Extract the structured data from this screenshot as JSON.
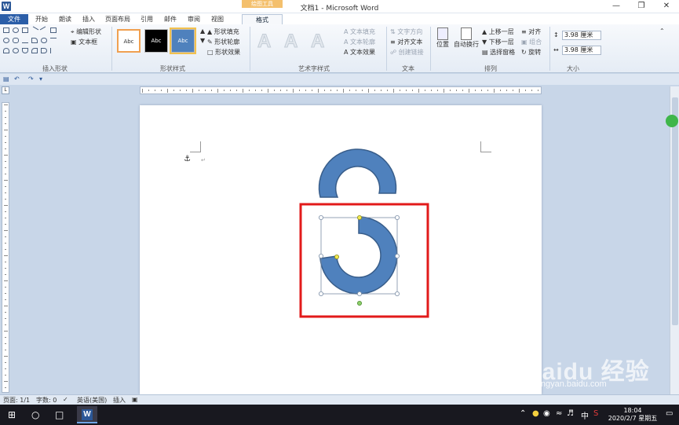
{
  "window": {
    "title": "文档1 - Microsoft Word",
    "context_tab_group": "绘图工具",
    "app_icon": "W"
  },
  "tabs": [
    "文件",
    "开始",
    "朗读",
    "插入",
    "页面布局",
    "引用",
    "邮件",
    "审阅",
    "视图",
    "格式"
  ],
  "ribbon": {
    "groups": {
      "insert_shapes": "插入形状",
      "shape_styles": "形状样式",
      "wordart_styles": "艺术字样式",
      "text": "文本",
      "arrange": "排列",
      "size": "大小"
    },
    "edit_shape": "编辑形状",
    "text_box": "文本框",
    "style_sample": "Abc",
    "shape_fill": "形状填充",
    "shape_outline": "形状轮廓",
    "shape_effects": "形状效果",
    "wordart_sample": "A",
    "text_fill": "文本填充",
    "text_outline": "文本轮廓",
    "text_effects": "文本效果",
    "text_direction": "文字方向",
    "align_text": "对齐文本",
    "create_link": "创建链接",
    "position": "位置",
    "auto_wrap": "自动换行",
    "bring_forward": "上移一层",
    "send_backward": "下移一层",
    "selection_pane": "选择窗格",
    "align": "对齐",
    "group": "组合",
    "rotate": "旋转",
    "height_value": "3.98 厘米",
    "width_value": "3.98 厘米"
  },
  "statusbar": {
    "page": "页面: 1/1",
    "words": "字数: 0",
    "language": "英语(美国)",
    "mode": "插入"
  },
  "taskbar": {
    "time": "18:04",
    "date": "2020/2/7 星期五",
    "ime": "中"
  },
  "watermark": {
    "text": "Baidu 经验",
    "sub": "jingyan.baidu.com"
  },
  "colors": {
    "shape_fill": "#4f81bd",
    "shape_stroke": "#385d8a",
    "highlight_box": "#e21a1a",
    "file_tab": "#2b5ea8"
  }
}
